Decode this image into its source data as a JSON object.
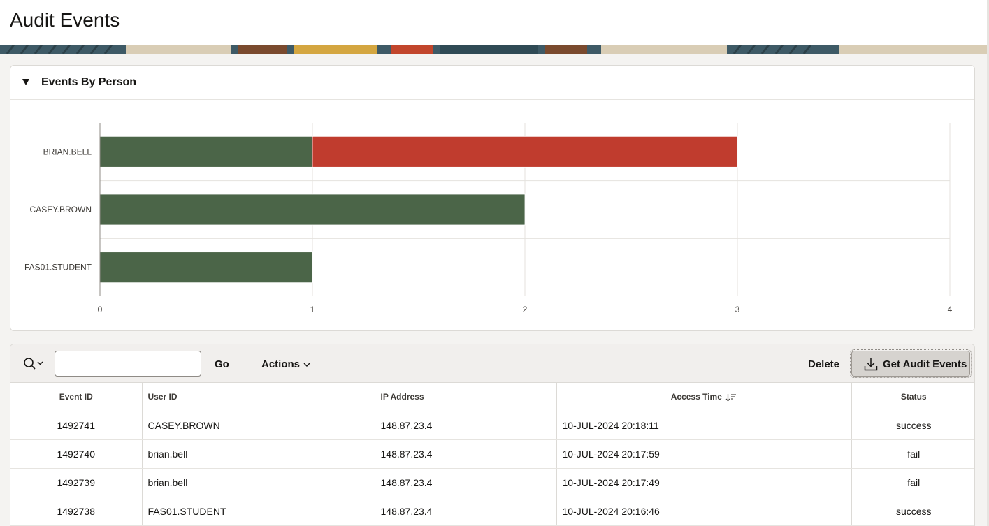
{
  "page": {
    "title": "Audit Events"
  },
  "region": {
    "title": "Events By Person"
  },
  "chart_data": {
    "type": "bar",
    "orientation": "horizontal",
    "stacked": true,
    "categories": [
      "BRIAN.BELL",
      "CASEY.BROWN",
      "FAS01.STUDENT"
    ],
    "series": [
      {
        "values": [
          1,
          2,
          1
        ],
        "color": "#4b6548"
      },
      {
        "values": [
          2,
          0,
          0
        ],
        "color": "#c03c2e"
      }
    ],
    "x_ticks": [
      "0",
      "1",
      "2",
      "3",
      "4"
    ],
    "xlim": [
      0,
      4
    ],
    "grid": true,
    "legend": "none"
  },
  "toolbar": {
    "search_icon": "search-icon",
    "search_placeholder": "",
    "go_label": "Go",
    "actions_label": "Actions",
    "delete_label": "Delete",
    "get_label": "Get Audit Events",
    "get_icon": "download-icon"
  },
  "table": {
    "columns": {
      "event_id": "Event ID",
      "user_id": "User ID",
      "ip": "IP Address",
      "access_time": "Access Time",
      "status": "Status"
    },
    "rows": [
      {
        "event_id": "1492741",
        "user_id": "CASEY.BROWN",
        "ip": "148.87.23.4",
        "access_time": "10-JUL-2024 20:18:11",
        "status": "success"
      },
      {
        "event_id": "1492740",
        "user_id": "brian.bell",
        "ip": "148.87.23.4",
        "access_time": "10-JUL-2024 20:17:59",
        "status": "fail"
      },
      {
        "event_id": "1492739",
        "user_id": "brian.bell",
        "ip": "148.87.23.4",
        "access_time": "10-JUL-2024 20:17:49",
        "status": "fail"
      },
      {
        "event_id": "1492738",
        "user_id": "FAS01.STUDENT",
        "ip": "148.87.23.4",
        "access_time": "10-JUL-2024 20:16:46",
        "status": "success"
      }
    ]
  }
}
